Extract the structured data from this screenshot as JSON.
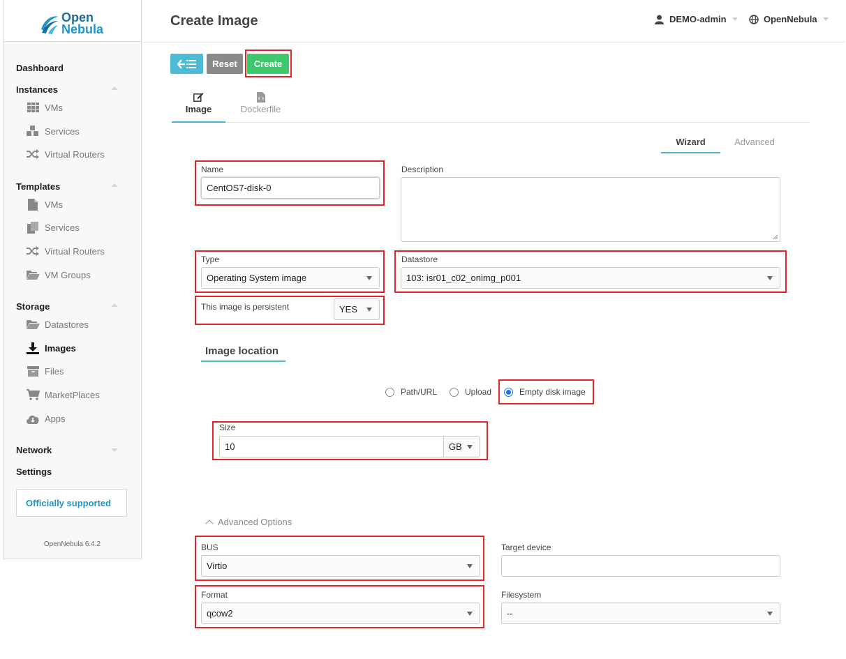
{
  "brand": {
    "line1": "Open",
    "line2": "Nebula"
  },
  "sidebar": {
    "dashboard": "Dashboard",
    "instances": {
      "label": "Instances",
      "items": [
        {
          "label": "VMs",
          "icon": "grid-icon"
        },
        {
          "label": "Services",
          "icon": "cubes-icon"
        },
        {
          "label": "Virtual Routers",
          "icon": "random-icon"
        }
      ]
    },
    "templates": {
      "label": "Templates",
      "items": [
        {
          "label": "VMs",
          "icon": "file-icon"
        },
        {
          "label": "Services",
          "icon": "copy-icon"
        },
        {
          "label": "Virtual Routers",
          "icon": "random-icon"
        },
        {
          "label": "VM Groups",
          "icon": "folder-open-icon"
        }
      ]
    },
    "storage": {
      "label": "Storage",
      "items": [
        {
          "label": "Datastores",
          "icon": "folder-open-icon"
        },
        {
          "label": "Images",
          "icon": "download-icon"
        },
        {
          "label": "Files",
          "icon": "archive-icon"
        },
        {
          "label": "MarketPlaces",
          "icon": "cart-icon"
        },
        {
          "label": "Apps",
          "icon": "cloud-download-icon"
        }
      ]
    },
    "network": "Network",
    "settings": "Settings",
    "supported": "Officially supported",
    "version": "OpenNebula 6.4.2"
  },
  "header": {
    "title": "Create Image",
    "user": "DEMO-admin",
    "zone": "OpenNebula"
  },
  "toolbar": {
    "reset": "Reset",
    "create": "Create"
  },
  "tabs": {
    "image": "Image",
    "dockerfile": "Dockerfile"
  },
  "modes": {
    "wizard": "Wizard",
    "advanced": "Advanced"
  },
  "form": {
    "name_label": "Name",
    "name_value": "CentOS7-disk-0",
    "description_label": "Description",
    "type_label": "Type",
    "type_value": "Operating System image",
    "datastore_label": "Datastore",
    "datastore_value": "103: isr01_c02_onimg_p001",
    "persistent_label": "This image is persistent",
    "persistent_value": "YES",
    "location_title": "Image location",
    "radio_path": "Path/URL",
    "radio_upload": "Upload",
    "radio_empty": "Empty disk image",
    "size_label": "Size",
    "size_value": "10",
    "size_unit": "GB",
    "advanced_toggle": "Advanced Options",
    "bus_label": "BUS",
    "bus_value": "Virtio",
    "target_label": "Target device",
    "target_value": "",
    "format_label": "Format",
    "format_value": "qcow2",
    "filesystem_label": "Filesystem",
    "filesystem_value": "--"
  },
  "colors": {
    "accent": "#4db3c9",
    "create_button": "#3fc86e",
    "back_button": "#4dbbd6",
    "reset_button": "#8a8a8a",
    "highlight_box": "#e3242b",
    "brand_dark": "#1d6f96",
    "brand_light": "#1e95c6"
  }
}
